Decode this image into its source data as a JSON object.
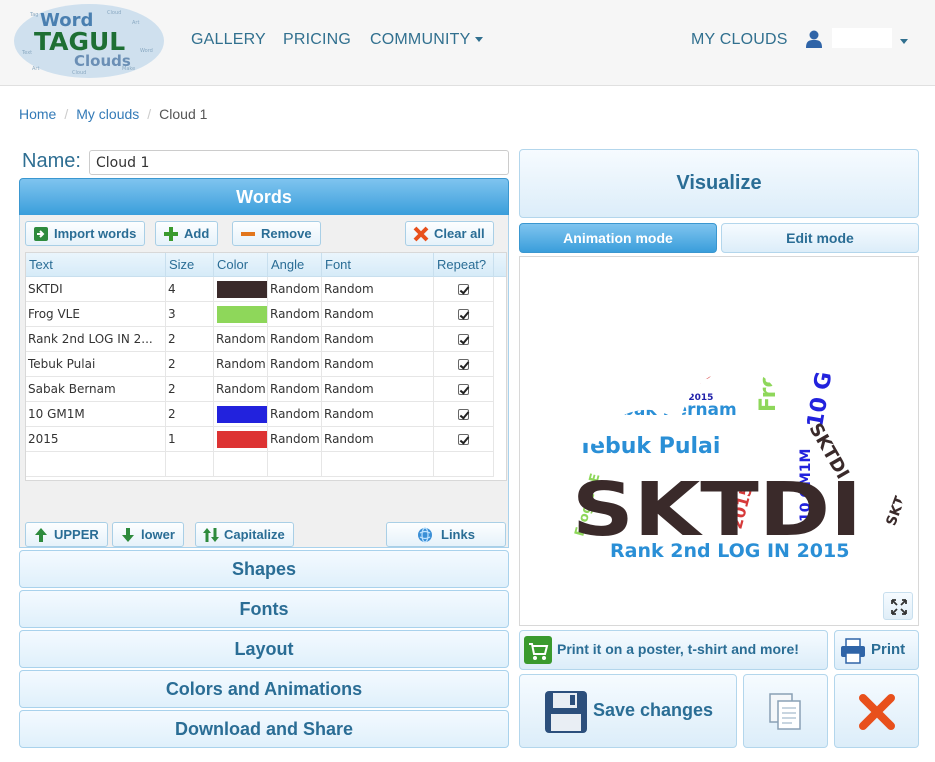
{
  "logo": {
    "lines": [
      "Word",
      "TAGUL",
      "Clouds"
    ]
  },
  "nav": {
    "gallery": "GALLERY",
    "pricing": "PRICING",
    "community": "COMMUNITY",
    "my_clouds": "MY CLOUDS"
  },
  "breadcrumb": {
    "home": "Home",
    "my_clouds": "My clouds",
    "current": "Cloud 1"
  },
  "name": {
    "label": "Name:",
    "value": "Cloud 1"
  },
  "panels": {
    "words": "Words",
    "shapes": "Shapes",
    "fonts": "Fonts",
    "layout": "Layout",
    "colors": "Colors and Animations",
    "download": "Download and Share"
  },
  "words_toolbar": {
    "import": "Import words",
    "add": "Add",
    "remove": "Remove",
    "clear": "Clear all",
    "upper": "UPPER",
    "lower": "lower",
    "capitalize": "Capitalize",
    "links": "Links"
  },
  "table": {
    "headers": {
      "text": "Text",
      "size": "Size",
      "color": "Color",
      "angle": "Angle",
      "font": "Font",
      "repeat": "Repeat?"
    },
    "rows": [
      {
        "text": "SKTDI",
        "size": "4",
        "color": "#3a2a2a",
        "color_text": "",
        "angle": "Random",
        "font": "Random"
      },
      {
        "text": "Frog VLE",
        "size": "3",
        "color": "#8ed75a",
        "color_text": "",
        "angle": "Random",
        "font": "Random"
      },
      {
        "text": "Rank 2nd LOG IN 2...",
        "size": "2",
        "color": "",
        "color_text": "Random",
        "angle": "Random",
        "font": "Random"
      },
      {
        "text": "Tebuk Pulai",
        "size": "2",
        "color": "",
        "color_text": "Random",
        "angle": "Random",
        "font": "Random"
      },
      {
        "text": "Sabak Bernam",
        "size": "2",
        "color": "",
        "color_text": "Random",
        "angle": "Random",
        "font": "Random"
      },
      {
        "text": "10 GM1M",
        "size": "2",
        "color": "#2222dd",
        "color_text": "",
        "angle": "Random",
        "font": "Random"
      },
      {
        "text": "2015",
        "size": "1",
        "color": "#dd3333",
        "color_text": "",
        "angle": "Random",
        "font": "Random"
      }
    ]
  },
  "right": {
    "visualize": "Visualize",
    "animation_mode": "Animation mode",
    "edit_mode": "Edit mode",
    "poster": "Print it on a poster, t-shirt and more!",
    "print": "Print",
    "save": "Save changes"
  },
  "cloud": {
    "big_word": "SKTDI",
    "words": [
      "2015",
      "Frog VLE",
      "10 GM1M",
      "SKTDI",
      "Sabak Bernam",
      "Rank 2nd LOG IN 2015",
      "Tebuk Pulai",
      "Rank 2nd LOG IN 2015",
      "Frog VLE",
      "10 GM1M",
      "SKTDI",
      "2015"
    ]
  },
  "colors": {
    "accent": "#3a9edb",
    "link": "#31708f",
    "text_blue": "#2a6d95"
  }
}
